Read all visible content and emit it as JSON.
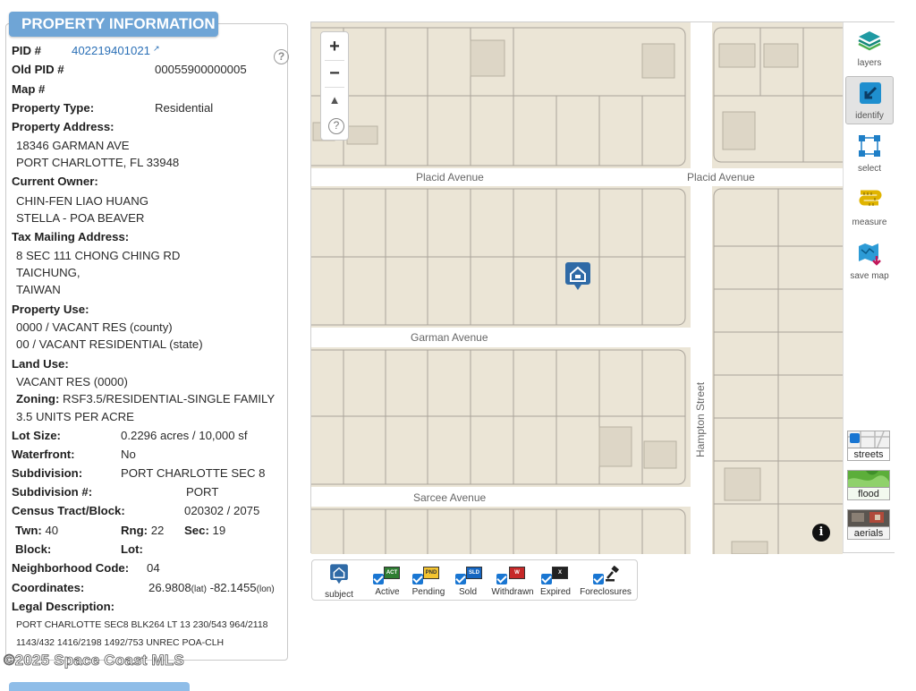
{
  "panel": {
    "title": "PROPERTY INFORMATION",
    "help": "?",
    "pid_label": "PID #",
    "pid_value": "402219401021",
    "old_pid_label": "Old PID #",
    "old_pid_value": "00055900000005",
    "map_label": "Map #",
    "property_type_label": "Property Type:",
    "property_type_value": "Residential",
    "address_label": "Property Address:",
    "address_line1": "18346 GARMAN AVE",
    "address_line2": "PORT CHARLOTTE, FL 33948",
    "owner_label": "Current Owner:",
    "owner_line1": "CHIN-FEN LIAO HUANG",
    "owner_line2": "STELLA - POA BEAVER",
    "mailing_label": "Tax Mailing Address:",
    "mailing_line1": "8 SEC 111 CHONG CHING RD",
    "mailing_line2": "TAICHUNG,",
    "mailing_line3": "TAIWAN",
    "use_label": "Property Use:",
    "use_line1": "0000 / VACANT RES (county)",
    "use_line2": "00 / VACANT RESIDENTIAL (state)",
    "land_use_label": "Land Use:",
    "land_use_value": "VACANT RES (0000)",
    "zoning_label": "Zoning:",
    "zoning_value": "RSF3.5/RESIDENTIAL-SINGLE FAMILY",
    "zoning_line2": "3.5 UNITS PER ACRE",
    "lot_size_label": "Lot Size:",
    "lot_size_value": "0.2296 acres / 10,000 sf",
    "waterfront_label": "Waterfront:",
    "waterfront_value": "No",
    "subdivision_label": "Subdivision:",
    "subdivision_value": "PORT CHARLOTTE SEC 8",
    "subdivision_num_label": "Subdivision #:",
    "subdivision_num_value": "PORT",
    "census_label": "Census Tract/Block:",
    "census_value": "020302 / 2075",
    "twn_label": "Twn:",
    "twn_value": "40",
    "rng_label": "Rng:",
    "rng_value": "22",
    "sec_label": "Sec:",
    "sec_value": "19",
    "block_label": "Block:",
    "lot_label": "Lot:",
    "neighborhood_label": "Neighborhood Code:",
    "neighborhood_value": "04",
    "coords_label": "Coordinates:",
    "lat_value": "26.9808",
    "lat_unit": "(lat)",
    "lon_value": "-82.1455",
    "lon_unit": "(lon)",
    "legal_label": "Legal Description:",
    "legal_line1": "PORT CHARLOTTE SEC8 BLK264 LT 13 230/543 964/2118",
    "legal_line2": "1143/432 1416/2198 1492/753 UNREC POA-CLH"
  },
  "watermark": "©2025 Space Coast MLS",
  "map": {
    "streets": {
      "placid_left": "Placid Avenue",
      "placid_right": "Placid Avenue",
      "garman": "Garman Avenue",
      "sarcee": "Sarcee Avenue",
      "hampton": "Hampton Street"
    },
    "zoom_in": "+",
    "zoom_out": "−",
    "compass": "▲",
    "help": "?",
    "info": "i",
    "colors": {
      "parcel_fill": "#ebe5d6",
      "parcel_line": "#a9a39a",
      "road": "#ffffff",
      "marker": "#2f6aa6"
    }
  },
  "toolbar": {
    "layers": "layers",
    "identify": "identify",
    "select": "select",
    "measure": "measure",
    "save_map": "save map",
    "streets": "streets",
    "flood": "flood",
    "aerials": "aerials"
  },
  "legend": {
    "subject": "subject",
    "active": "Active",
    "pending": "Pending",
    "sold": "Sold",
    "withdrawn": "Withdrawn",
    "expired": "Expired",
    "foreclosures": "Foreclosures",
    "active_sign": "ACT",
    "pending_sign": "PND",
    "sold_sign": "SLD",
    "withdrawn_sign": "W",
    "expired_sign": "X"
  }
}
